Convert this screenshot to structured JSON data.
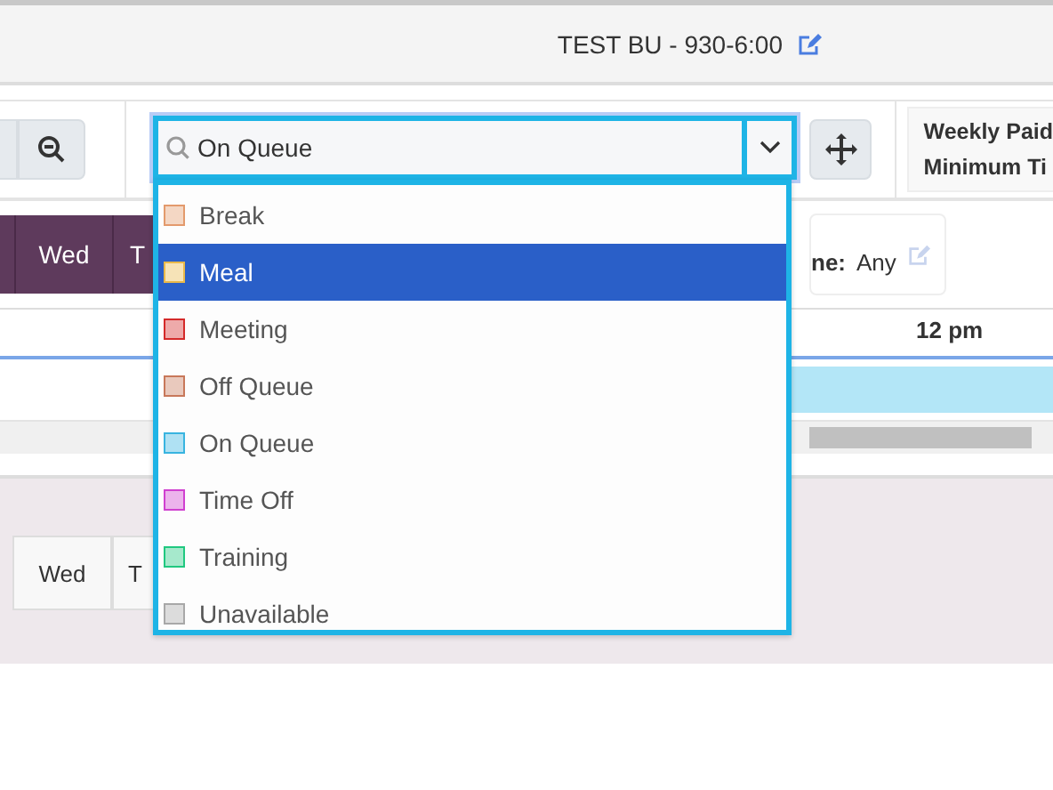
{
  "header": {
    "title": "TEST BU - 930-6:00"
  },
  "select": {
    "value": "On Queue",
    "expanded": true
  },
  "options": [
    {
      "label": "Break",
      "color": "#e39a6c",
      "selected": false
    },
    {
      "label": "Meal",
      "color": "#e8b84a",
      "selected": true
    },
    {
      "label": "Meeting",
      "color": "#d42a2a",
      "selected": false
    },
    {
      "label": "Off Queue",
      "color": "#c8785a",
      "selected": false
    },
    {
      "label": "On Queue",
      "color": "#38b4e0",
      "selected": false
    },
    {
      "label": "Time Off",
      "color": "#d040d0",
      "selected": false
    },
    {
      "label": "Training",
      "color": "#20c880",
      "selected": false
    },
    {
      "label": "Unavailable",
      "color": "#a8a8a8",
      "selected": false
    }
  ],
  "summary": {
    "lines": [
      "Weekly Paid",
      "Minimum Ti"
    ]
  },
  "day_tabs_top": [
    "Wed",
    "T"
  ],
  "card": {
    "label": "ne:",
    "value": "Any"
  },
  "ruler": {
    "label": "12 pm"
  },
  "day_tabs_bottom": [
    "Wed",
    "T"
  ]
}
